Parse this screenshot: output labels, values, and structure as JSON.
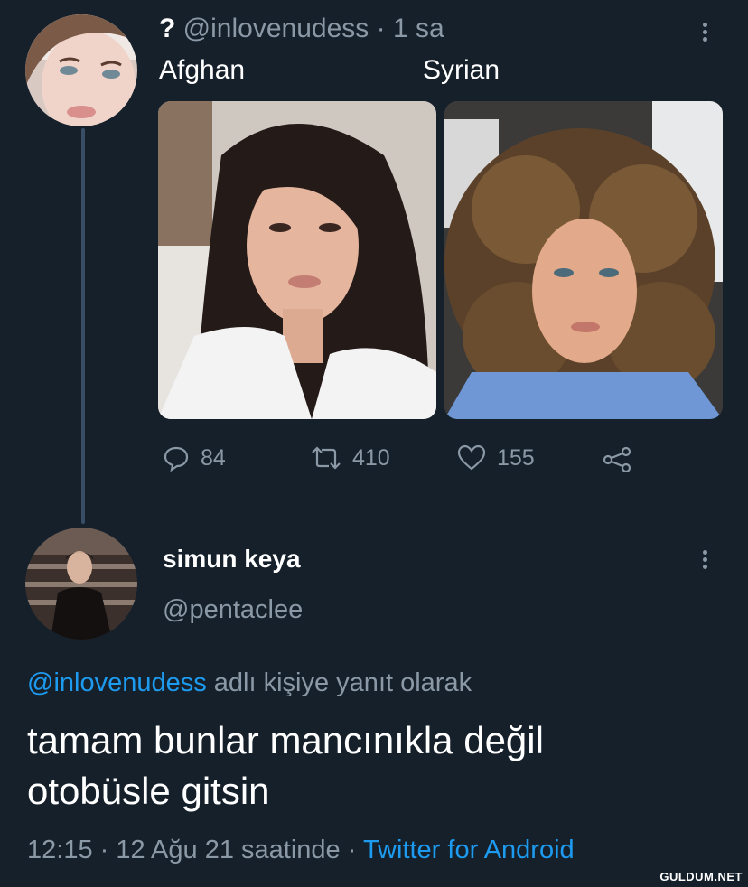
{
  "tweet1": {
    "avatar_alt": "profile photo of a woman with pale skin",
    "name_mark": "?",
    "handle": "@inlovenudess",
    "separator": "·",
    "time": "1 sa",
    "caption_left": "Afghan",
    "caption_right": "Syrian",
    "actions": {
      "replies": "84",
      "retweets": "410",
      "likes": "155"
    }
  },
  "tweet2": {
    "name": "simun keya",
    "handle": "@pentaclee",
    "reply_to_handle": "@inlovenudess",
    "reply_to_suffix": "adlı kişiye yanıt olarak",
    "text_line1": "tamam bunlar mancınıkla değil",
    "text_line2": "otobüsle gitsin",
    "timestamp": "12:15 · 12 Ağu 21 saatinde ·",
    "source": "Twitter for Android"
  },
  "watermark": "GULDUM.NET",
  "colors": {
    "background": "#15202b",
    "link": "#1d9bf0",
    "muted": "#8b98a5",
    "thread_line": "#3a4d66"
  },
  "icons": [
    "more-vertical-icon",
    "reply-icon",
    "retweet-icon",
    "like-icon",
    "share-icon"
  ]
}
